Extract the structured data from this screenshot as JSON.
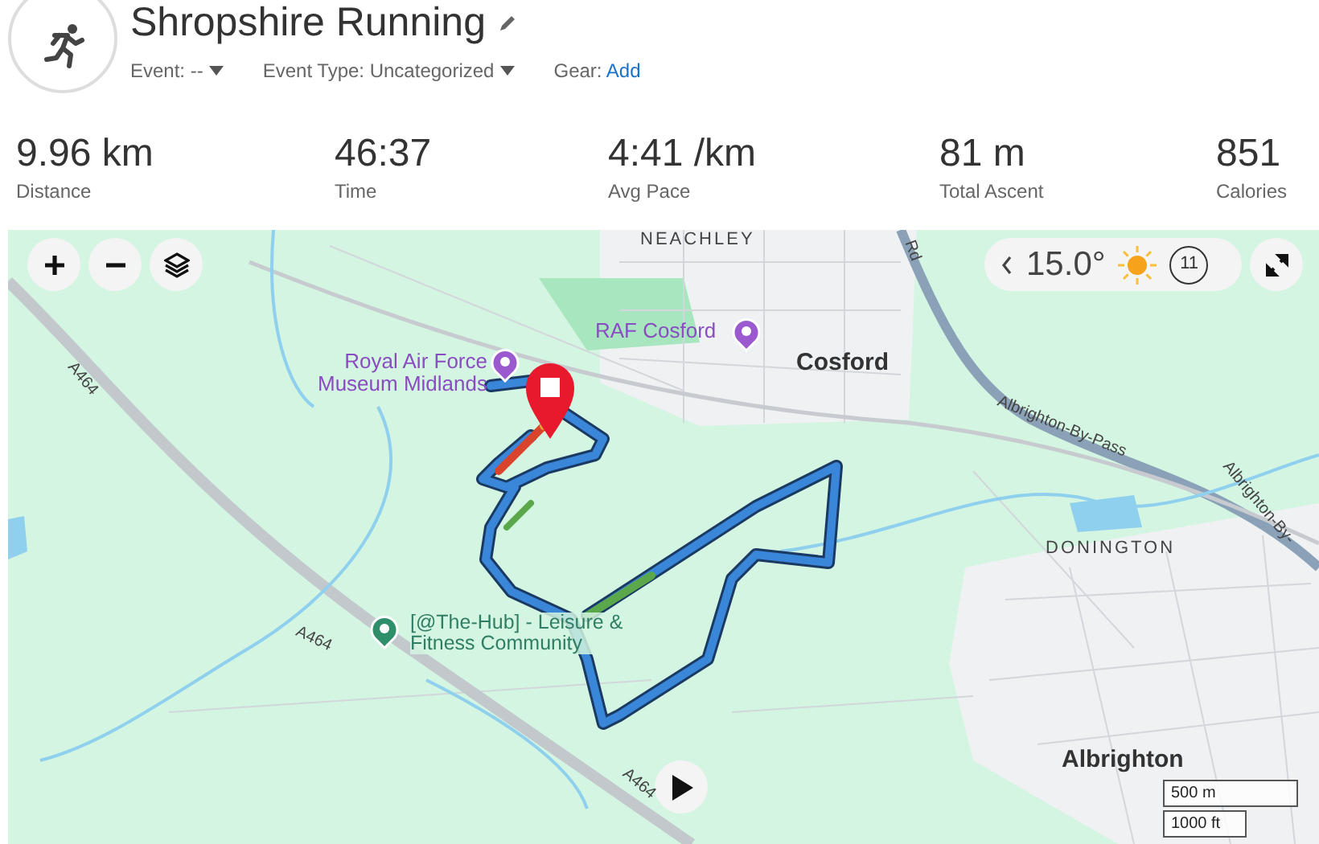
{
  "activity": {
    "title": "Shropshire Running"
  },
  "meta": [
    {
      "label": "Event:",
      "value": "--",
      "kind": "dropdown"
    },
    {
      "label": "Event Type:",
      "value": "Uncategorized",
      "kind": "dropdown"
    },
    {
      "label": "Gear:",
      "value": "Add",
      "kind": "link"
    }
  ],
  "stats": [
    {
      "value": "9.96 km",
      "label": "Distance"
    },
    {
      "value": "46:37",
      "label": "Time"
    },
    {
      "value": "4:41 /km",
      "label": "Avg Pace"
    },
    {
      "value": "81 m",
      "label": "Total Ascent"
    },
    {
      "value": "851",
      "label": "Calories"
    }
  ],
  "map": {
    "weather": {
      "temperature": "15.0°",
      "wind": "11"
    },
    "labels": [
      {
        "text": "NEACHLEY",
        "kind": "area"
      },
      {
        "text": "RAF Cosford",
        "kind": "poi"
      },
      {
        "text": "Royal Air Force Museum Midlands",
        "kind": "poi"
      },
      {
        "text": "Cosford",
        "kind": "place"
      },
      {
        "text": "A464",
        "kind": "road"
      },
      {
        "text": "A464",
        "kind": "road"
      },
      {
        "text": "A464",
        "kind": "road"
      },
      {
        "text": "Rd",
        "kind": "road"
      },
      {
        "text": "Albrighton-By-Pass",
        "kind": "road"
      },
      {
        "text": "Albrighton-By-",
        "kind": "road"
      },
      {
        "text": "DONINGTON",
        "kind": "area"
      },
      {
        "text": "[@The-Hub] - Leisure & Fitness Community",
        "kind": "venue"
      },
      {
        "text": "Albrighton",
        "kind": "place"
      }
    ],
    "scale": [
      "500 m",
      "1000 ft"
    ]
  }
}
